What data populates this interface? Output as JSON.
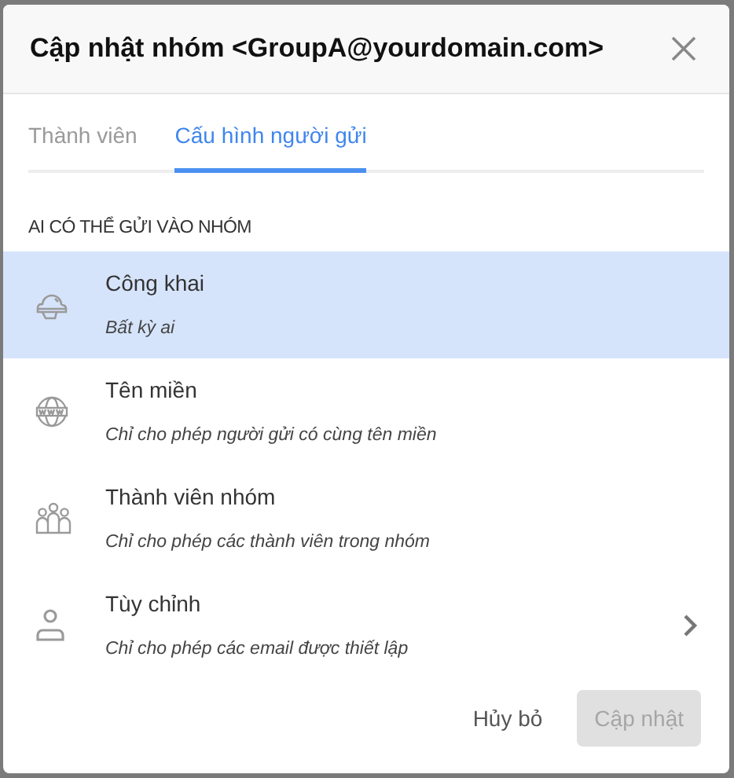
{
  "dialog": {
    "title": "Cập nhật nhóm <GroupA@yourdomain.com>"
  },
  "tabs": [
    {
      "label": "Thành viên",
      "selected": false
    },
    {
      "label": "Cấu hình người gửi",
      "selected": true
    }
  ],
  "section_label": "AI CÓ THỂ GỬI VÀO NHÓM",
  "options": [
    {
      "title": "Công khai",
      "description": "Bất kỳ ai",
      "selected": true,
      "has_submenu": false
    },
    {
      "title": "Tên miền",
      "description": "Chỉ cho phép người gửi có cùng tên miền",
      "selected": false,
      "has_submenu": false
    },
    {
      "title": "Thành viên nhóm",
      "description": "Chỉ cho phép các thành viên trong nhóm",
      "selected": false,
      "has_submenu": false
    },
    {
      "title": "Tùy chỉnh",
      "description": "Chỉ cho phép các email được thiết lập",
      "selected": false,
      "has_submenu": true
    }
  ],
  "buttons": [
    {
      "label": "Hủy bỏ",
      "kind": "text",
      "disabled": false
    },
    {
      "label": "Cập nhật",
      "kind": "filled",
      "disabled": true
    }
  ]
}
